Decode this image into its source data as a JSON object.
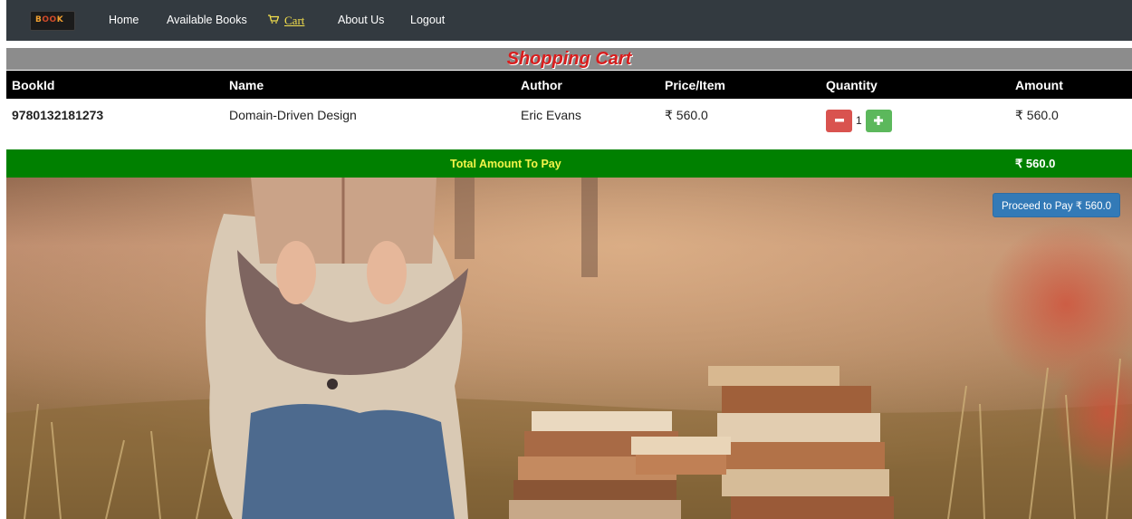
{
  "nav": {
    "logo_text_left": "B",
    "logo_text_mid": "OO",
    "logo_text_right": "K",
    "links": [
      {
        "label": "Home"
      },
      {
        "label": "Available Books"
      },
      {
        "label": "Cart"
      },
      {
        "label": "About Us"
      },
      {
        "label": "Logout"
      }
    ]
  },
  "cart": {
    "title": "Shopping Cart",
    "columns": [
      "BookId",
      "Name",
      "Author",
      "Price/Item",
      "Quantity",
      "Amount"
    ],
    "rows": [
      {
        "book_id": "9780132181273",
        "name": "Domain-Driven Design",
        "author": "Eric Evans",
        "price": "₹ 560.0",
        "quantity": "1",
        "amount": "₹ 560.0"
      }
    ],
    "total_label": "Total Amount To Pay",
    "total_value": "₹ 560.0",
    "pay_button": "Proceed to Pay ₹ 560.0"
  },
  "colors": {
    "navbar": "#333a40",
    "title_bar": "#8c8c8c",
    "title_text": "#d81e1e",
    "header_bg": "#000000",
    "total_bg": "#008000",
    "total_label": "#f4f44a",
    "minus_button": "#d9534f",
    "plus_button": "#5cb85c",
    "pay_button": "#337ab7"
  },
  "icons": {
    "cart": "shopping-cart-icon",
    "minus": "minus-icon",
    "plus": "plus-icon"
  }
}
